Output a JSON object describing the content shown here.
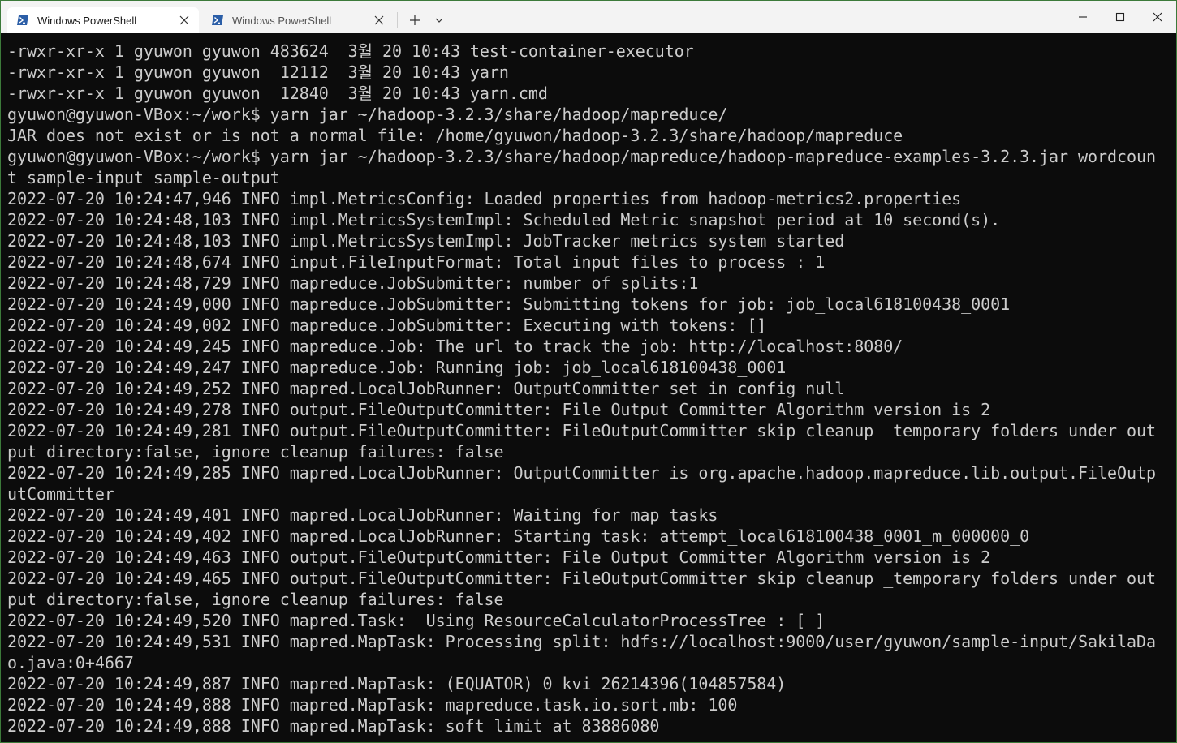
{
  "window": {
    "tabs": [
      {
        "title": "Windows PowerShell",
        "active": true,
        "icon": "powershell-icon"
      },
      {
        "title": "Windows PowerShell",
        "active": false,
        "icon": "powershell-icon"
      }
    ],
    "controls": {
      "new_tab": "+",
      "dropdown": "chevron-down-icon",
      "minimize": "minimize-icon",
      "maximize": "maximize-icon",
      "close": "close-icon"
    },
    "colors": {
      "border": "#3c7a3a",
      "titlebar": "#f3f3f3",
      "terminal_bg": "#0c0c0c",
      "terminal_fg": "#cccccc",
      "ps_icon": "#2b5ea7"
    }
  },
  "terminal": {
    "lines": [
      "-rwxr-xr-x 1 gyuwon gyuwon 483624  3월 20 10:43 test-container-executor",
      "-rwxr-xr-x 1 gyuwon gyuwon  12112  3월 20 10:43 yarn",
      "-rwxr-xr-x 1 gyuwon gyuwon  12840  3월 20 10:43 yarn.cmd",
      "gyuwon@gyuwon-VBox:~/work$ yarn jar ~/hadoop-3.2.3/share/hadoop/mapreduce/",
      "JAR does not exist or is not a normal file: /home/gyuwon/hadoop-3.2.3/share/hadoop/mapreduce",
      "gyuwon@gyuwon-VBox:~/work$ yarn jar ~/hadoop-3.2.3/share/hadoop/mapreduce/hadoop-mapreduce-examples-3.2.3.jar wordcoun",
      "t sample-input sample-output",
      "2022-07-20 10:24:47,946 INFO impl.MetricsConfig: Loaded properties from hadoop-metrics2.properties",
      "2022-07-20 10:24:48,103 INFO impl.MetricsSystemImpl: Scheduled Metric snapshot period at 10 second(s).",
      "2022-07-20 10:24:48,103 INFO impl.MetricsSystemImpl: JobTracker metrics system started",
      "2022-07-20 10:24:48,674 INFO input.FileInputFormat: Total input files to process : 1",
      "2022-07-20 10:24:48,729 INFO mapreduce.JobSubmitter: number of splits:1",
      "2022-07-20 10:24:49,000 INFO mapreduce.JobSubmitter: Submitting tokens for job: job_local618100438_0001",
      "2022-07-20 10:24:49,002 INFO mapreduce.JobSubmitter: Executing with tokens: []",
      "2022-07-20 10:24:49,245 INFO mapreduce.Job: The url to track the job: http://localhost:8080/",
      "2022-07-20 10:24:49,247 INFO mapreduce.Job: Running job: job_local618100438_0001",
      "2022-07-20 10:24:49,252 INFO mapred.LocalJobRunner: OutputCommitter set in config null",
      "2022-07-20 10:24:49,278 INFO output.FileOutputCommitter: File Output Committer Algorithm version is 2",
      "2022-07-20 10:24:49,281 INFO output.FileOutputCommitter: FileOutputCommitter skip cleanup _temporary folders under out",
      "put directory:false, ignore cleanup failures: false",
      "2022-07-20 10:24:49,285 INFO mapred.LocalJobRunner: OutputCommitter is org.apache.hadoop.mapreduce.lib.output.FileOutp",
      "utCommitter",
      "2022-07-20 10:24:49,401 INFO mapred.LocalJobRunner: Waiting for map tasks",
      "2022-07-20 10:24:49,402 INFO mapred.LocalJobRunner: Starting task: attempt_local618100438_0001_m_000000_0",
      "2022-07-20 10:24:49,463 INFO output.FileOutputCommitter: File Output Committer Algorithm version is 2",
      "2022-07-20 10:24:49,465 INFO output.FileOutputCommitter: FileOutputCommitter skip cleanup _temporary folders under out",
      "put directory:false, ignore cleanup failures: false",
      "2022-07-20 10:24:49,520 INFO mapred.Task:  Using ResourceCalculatorProcessTree : [ ]",
      "2022-07-20 10:24:49,531 INFO mapred.MapTask: Processing split: hdfs://localhost:9000/user/gyuwon/sample-input/SakilaDa",
      "o.java:0+4667",
      "2022-07-20 10:24:49,887 INFO mapred.MapTask: (EQUATOR) 0 kvi 26214396(104857584)",
      "2022-07-20 10:24:49,888 INFO mapred.MapTask: mapreduce.task.io.sort.mb: 100",
      "2022-07-20 10:24:49,888 INFO mapred.MapTask: soft limit at 83886080"
    ]
  }
}
